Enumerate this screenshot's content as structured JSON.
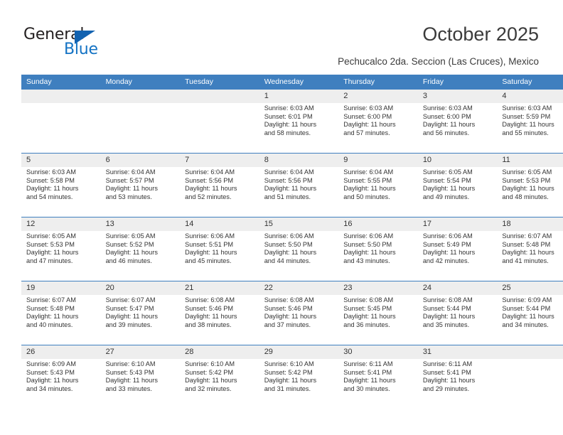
{
  "brand": {
    "name_top": "General",
    "name_bottom": "Blue",
    "triangle_color": "#1262b0",
    "blue_text_color": "#1473c4"
  },
  "header": {
    "title": "October 2025",
    "subtitle": "Pechucalco 2da. Seccion (Las Cruces), Mexico"
  },
  "theme": {
    "header_row_bg": "#3f7fbf",
    "daynum_bg": "#eeeeee",
    "grid_line": "#3f7fbf",
    "text": "#333333"
  },
  "weekday_headers": [
    "Sunday",
    "Monday",
    "Tuesday",
    "Wednesday",
    "Thursday",
    "Friday",
    "Saturday"
  ],
  "weeks": [
    [
      {
        "day": "",
        "empty": true,
        "sunrise": "",
        "sunset": "",
        "daylight_1": "",
        "daylight_2": ""
      },
      {
        "day": "",
        "empty": true,
        "sunrise": "",
        "sunset": "",
        "daylight_1": "",
        "daylight_2": ""
      },
      {
        "day": "",
        "empty": true,
        "sunrise": "",
        "sunset": "",
        "daylight_1": "",
        "daylight_2": ""
      },
      {
        "day": "1",
        "empty": false,
        "sunrise": "Sunrise: 6:03 AM",
        "sunset": "Sunset: 6:01 PM",
        "daylight_1": "Daylight: 11 hours",
        "daylight_2": "and 58 minutes."
      },
      {
        "day": "2",
        "empty": false,
        "sunrise": "Sunrise: 6:03 AM",
        "sunset": "Sunset: 6:00 PM",
        "daylight_1": "Daylight: 11 hours",
        "daylight_2": "and 57 minutes."
      },
      {
        "day": "3",
        "empty": false,
        "sunrise": "Sunrise: 6:03 AM",
        "sunset": "Sunset: 6:00 PM",
        "daylight_1": "Daylight: 11 hours",
        "daylight_2": "and 56 minutes."
      },
      {
        "day": "4",
        "empty": false,
        "sunrise": "Sunrise: 6:03 AM",
        "sunset": "Sunset: 5:59 PM",
        "daylight_1": "Daylight: 11 hours",
        "daylight_2": "and 55 minutes."
      }
    ],
    [
      {
        "day": "5",
        "empty": false,
        "sunrise": "Sunrise: 6:03 AM",
        "sunset": "Sunset: 5:58 PM",
        "daylight_1": "Daylight: 11 hours",
        "daylight_2": "and 54 minutes."
      },
      {
        "day": "6",
        "empty": false,
        "sunrise": "Sunrise: 6:04 AM",
        "sunset": "Sunset: 5:57 PM",
        "daylight_1": "Daylight: 11 hours",
        "daylight_2": "and 53 minutes."
      },
      {
        "day": "7",
        "empty": false,
        "sunrise": "Sunrise: 6:04 AM",
        "sunset": "Sunset: 5:56 PM",
        "daylight_1": "Daylight: 11 hours",
        "daylight_2": "and 52 minutes."
      },
      {
        "day": "8",
        "empty": false,
        "sunrise": "Sunrise: 6:04 AM",
        "sunset": "Sunset: 5:56 PM",
        "daylight_1": "Daylight: 11 hours",
        "daylight_2": "and 51 minutes."
      },
      {
        "day": "9",
        "empty": false,
        "sunrise": "Sunrise: 6:04 AM",
        "sunset": "Sunset: 5:55 PM",
        "daylight_1": "Daylight: 11 hours",
        "daylight_2": "and 50 minutes."
      },
      {
        "day": "10",
        "empty": false,
        "sunrise": "Sunrise: 6:05 AM",
        "sunset": "Sunset: 5:54 PM",
        "daylight_1": "Daylight: 11 hours",
        "daylight_2": "and 49 minutes."
      },
      {
        "day": "11",
        "empty": false,
        "sunrise": "Sunrise: 6:05 AM",
        "sunset": "Sunset: 5:53 PM",
        "daylight_1": "Daylight: 11 hours",
        "daylight_2": "and 48 minutes."
      }
    ],
    [
      {
        "day": "12",
        "empty": false,
        "sunrise": "Sunrise: 6:05 AM",
        "sunset": "Sunset: 5:53 PM",
        "daylight_1": "Daylight: 11 hours",
        "daylight_2": "and 47 minutes."
      },
      {
        "day": "13",
        "empty": false,
        "sunrise": "Sunrise: 6:05 AM",
        "sunset": "Sunset: 5:52 PM",
        "daylight_1": "Daylight: 11 hours",
        "daylight_2": "and 46 minutes."
      },
      {
        "day": "14",
        "empty": false,
        "sunrise": "Sunrise: 6:06 AM",
        "sunset": "Sunset: 5:51 PM",
        "daylight_1": "Daylight: 11 hours",
        "daylight_2": "and 45 minutes."
      },
      {
        "day": "15",
        "empty": false,
        "sunrise": "Sunrise: 6:06 AM",
        "sunset": "Sunset: 5:50 PM",
        "daylight_1": "Daylight: 11 hours",
        "daylight_2": "and 44 minutes."
      },
      {
        "day": "16",
        "empty": false,
        "sunrise": "Sunrise: 6:06 AM",
        "sunset": "Sunset: 5:50 PM",
        "daylight_1": "Daylight: 11 hours",
        "daylight_2": "and 43 minutes."
      },
      {
        "day": "17",
        "empty": false,
        "sunrise": "Sunrise: 6:06 AM",
        "sunset": "Sunset: 5:49 PM",
        "daylight_1": "Daylight: 11 hours",
        "daylight_2": "and 42 minutes."
      },
      {
        "day": "18",
        "empty": false,
        "sunrise": "Sunrise: 6:07 AM",
        "sunset": "Sunset: 5:48 PM",
        "daylight_1": "Daylight: 11 hours",
        "daylight_2": "and 41 minutes."
      }
    ],
    [
      {
        "day": "19",
        "empty": false,
        "sunrise": "Sunrise: 6:07 AM",
        "sunset": "Sunset: 5:48 PM",
        "daylight_1": "Daylight: 11 hours",
        "daylight_2": "and 40 minutes."
      },
      {
        "day": "20",
        "empty": false,
        "sunrise": "Sunrise: 6:07 AM",
        "sunset": "Sunset: 5:47 PM",
        "daylight_1": "Daylight: 11 hours",
        "daylight_2": "and 39 minutes."
      },
      {
        "day": "21",
        "empty": false,
        "sunrise": "Sunrise: 6:08 AM",
        "sunset": "Sunset: 5:46 PM",
        "daylight_1": "Daylight: 11 hours",
        "daylight_2": "and 38 minutes."
      },
      {
        "day": "22",
        "empty": false,
        "sunrise": "Sunrise: 6:08 AM",
        "sunset": "Sunset: 5:46 PM",
        "daylight_1": "Daylight: 11 hours",
        "daylight_2": "and 37 minutes."
      },
      {
        "day": "23",
        "empty": false,
        "sunrise": "Sunrise: 6:08 AM",
        "sunset": "Sunset: 5:45 PM",
        "daylight_1": "Daylight: 11 hours",
        "daylight_2": "and 36 minutes."
      },
      {
        "day": "24",
        "empty": false,
        "sunrise": "Sunrise: 6:08 AM",
        "sunset": "Sunset: 5:44 PM",
        "daylight_1": "Daylight: 11 hours",
        "daylight_2": "and 35 minutes."
      },
      {
        "day": "25",
        "empty": false,
        "sunrise": "Sunrise: 6:09 AM",
        "sunset": "Sunset: 5:44 PM",
        "daylight_1": "Daylight: 11 hours",
        "daylight_2": "and 34 minutes."
      }
    ],
    [
      {
        "day": "26",
        "empty": false,
        "sunrise": "Sunrise: 6:09 AM",
        "sunset": "Sunset: 5:43 PM",
        "daylight_1": "Daylight: 11 hours",
        "daylight_2": "and 34 minutes."
      },
      {
        "day": "27",
        "empty": false,
        "sunrise": "Sunrise: 6:10 AM",
        "sunset": "Sunset: 5:43 PM",
        "daylight_1": "Daylight: 11 hours",
        "daylight_2": "and 33 minutes."
      },
      {
        "day": "28",
        "empty": false,
        "sunrise": "Sunrise: 6:10 AM",
        "sunset": "Sunset: 5:42 PM",
        "daylight_1": "Daylight: 11 hours",
        "daylight_2": "and 32 minutes."
      },
      {
        "day": "29",
        "empty": false,
        "sunrise": "Sunrise: 6:10 AM",
        "sunset": "Sunset: 5:42 PM",
        "daylight_1": "Daylight: 11 hours",
        "daylight_2": "and 31 minutes."
      },
      {
        "day": "30",
        "empty": false,
        "sunrise": "Sunrise: 6:11 AM",
        "sunset": "Sunset: 5:41 PM",
        "daylight_1": "Daylight: 11 hours",
        "daylight_2": "and 30 minutes."
      },
      {
        "day": "31",
        "empty": false,
        "sunrise": "Sunrise: 6:11 AM",
        "sunset": "Sunset: 5:41 PM",
        "daylight_1": "Daylight: 11 hours",
        "daylight_2": "and 29 minutes."
      },
      {
        "day": "",
        "empty": true,
        "sunrise": "",
        "sunset": "",
        "daylight_1": "",
        "daylight_2": ""
      }
    ]
  ]
}
